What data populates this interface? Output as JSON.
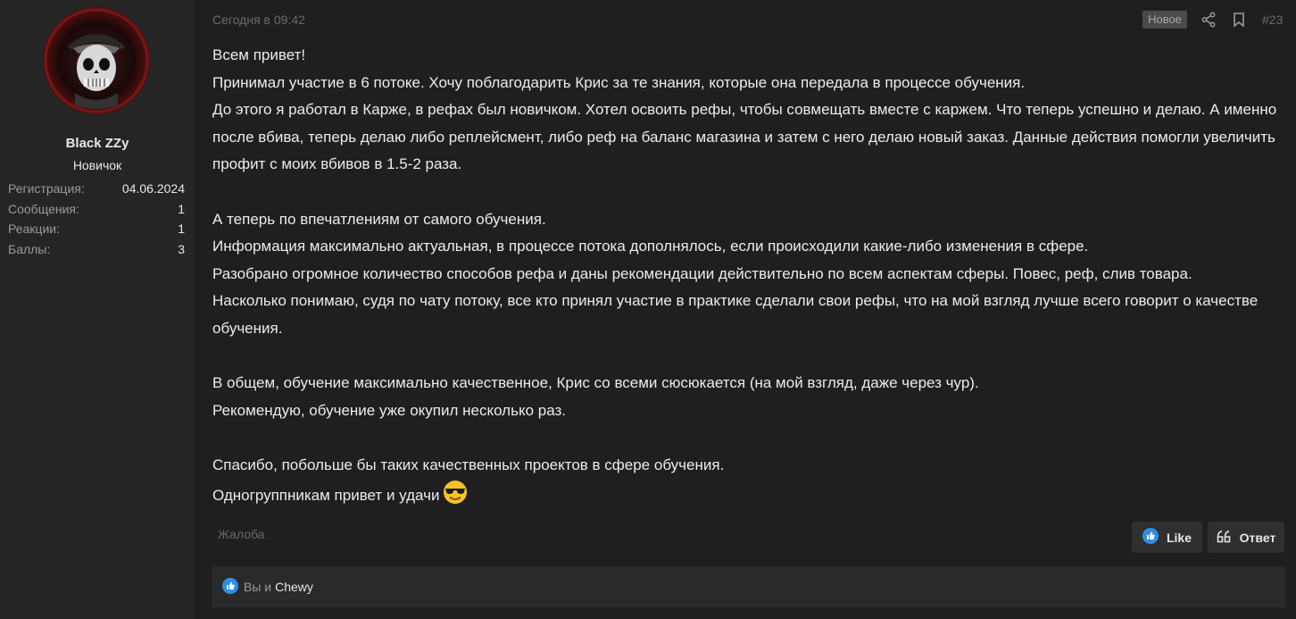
{
  "user": {
    "name": "Black ZZy",
    "title": "Новичок",
    "stats": [
      {
        "label": "Регистрация:",
        "value": "04.06.2024"
      },
      {
        "label": "Сообщения:",
        "value": "1"
      },
      {
        "label": "Реакции:",
        "value": "1"
      },
      {
        "label": "Баллы:",
        "value": "3"
      }
    ]
  },
  "post": {
    "date": "Сегодня в 09:42",
    "badge": "Новое",
    "number": "#23",
    "paragraphs": [
      "Всем привет!",
      "Принимал участие в 6 потоке. Хочу поблагодарить Крис за те знания, которые она передала в процессе обучения.",
      "До этого я работал в Карже, в рефах был новичком. Хотел освоить рефы, чтобы совмещать вместе с каржем. Что теперь успешно и делаю. А именно после вбива, теперь делаю либо реплейсмент, либо реф на баланс магазина и затем с него делаю новый заказ. Данные действия помогли увеличить профит с моих вбивов в 1.5-2 раза.",
      "",
      "А теперь по впечатлениям от самого обучения.",
      "Информация максимально актуальная, в процессе потока дополнялось, если происходили какие-либо изменения в сфере.",
      "Разобрано огромное количество способов рефа и даны рекомендации действительно по всем аспектам сферы. Повес, реф, слив товара.",
      "Насколько понимаю, судя по чату потоку, все кто принял участие в практике сделали свои рефы, что на мой взгляд лучше всего говорит о качестве обучения.",
      "",
      "В общем, обучение максимально качественное, Крис со всеми сюсюкается (на мой взгляд, даже через чур).",
      "Рекомендую, обучение уже окупил несколько раз.",
      "",
      "Спасибо, побольше бы таких качественных проектов в сфере обучения."
    ],
    "last_line": "Одногруппникам привет и удачи"
  },
  "actions": {
    "complaint": "Жалоба",
    "like": "Like",
    "reply": "Ответ"
  },
  "reactions": {
    "you": "Вы и",
    "who": "Chewy"
  },
  "icons": {
    "share": "share-icon",
    "bookmark": "bookmark-icon",
    "like": "thumbs-up-icon",
    "reply": "quote-icon",
    "emoji": "sunglasses-emoji"
  },
  "colors": {
    "background": "#1f1f1f",
    "sidebar": "#252525",
    "like_blue": "#2e8fe0"
  }
}
